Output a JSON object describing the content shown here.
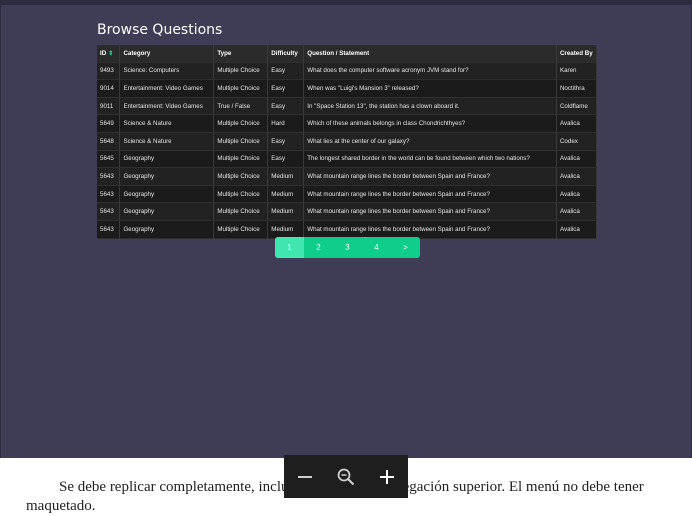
{
  "page": {
    "title": "Browse Questions"
  },
  "table": {
    "columns": {
      "id": "ID",
      "category": "Category",
      "type": "Type",
      "difficulty": "Difficulty",
      "question": "Question / Statement",
      "created_by": "Created By"
    },
    "rows": [
      {
        "id": "9493",
        "category": "Science: Computers",
        "type": "Multiple Choice",
        "difficulty": "Easy",
        "question": "What does the computer software acronym JVM stand for?",
        "created_by": "Karen"
      },
      {
        "id": "9014",
        "category": "Entertainment: Video Games",
        "type": "Multiple Choice",
        "difficulty": "Easy",
        "question": "When was \"Luigi's Mansion 3\" released?",
        "created_by": "Noctithra"
      },
      {
        "id": "9011",
        "category": "Entertainment: Video Games",
        "type": "True / False",
        "difficulty": "Easy",
        "question": "In \"Space Station 13\", the station has a clown aboard it.",
        "created_by": "Coldflame"
      },
      {
        "id": "5649",
        "category": "Science & Nature",
        "type": "Multiple Choice",
        "difficulty": "Hard",
        "question": "Which of these animals belongs in class Chondrichthyes?",
        "created_by": "Avalica"
      },
      {
        "id": "5648",
        "category": "Science & Nature",
        "type": "Multiple Choice",
        "difficulty": "Easy",
        "question": "What lies at the center of our galaxy?",
        "created_by": "Codex"
      },
      {
        "id": "5645",
        "category": "Geography",
        "type": "Multiple Choice",
        "difficulty": "Easy",
        "question": "The longest shared border in the world can be found between which two nations?",
        "created_by": "Avalica"
      },
      {
        "id": "5643",
        "category": "Geography",
        "type": "Multiple Choice",
        "difficulty": "Medium",
        "question": "What mountain range lines the border between Spain and France?",
        "created_by": "Avalica"
      },
      {
        "id": "5643",
        "category": "Geography",
        "type": "Multiple Choice",
        "difficulty": "Medium",
        "question": "What mountain range lines the border between Spain and France?",
        "created_by": "Avalica"
      },
      {
        "id": "5643",
        "category": "Geography",
        "type": "Multiple Choice",
        "difficulty": "Medium",
        "question": "What mountain range lines the border between Spain and France?",
        "created_by": "Avalica"
      },
      {
        "id": "5643",
        "category": "Geography",
        "type": "Multiple Choice",
        "difficulty": "Medium",
        "question": "What mountain range lines the border between Spain and France?",
        "created_by": "Avalica"
      }
    ]
  },
  "pagination": {
    "pages": [
      "1",
      "2",
      "3",
      "4",
      ">"
    ],
    "active": "1"
  },
  "zoom_controls": {
    "icons": [
      "minus-icon",
      "zoom-reset-icon",
      "plus-icon"
    ]
  },
  "document": {
    "line1": "Se debe replicar completamente, incluido el menú de navegación superior. El menú no debe tener",
    "line2": "maquetado."
  },
  "colors": {
    "viewer_bg": "#3f3d55",
    "table_bg": "#222222",
    "accent": "#1fe39a",
    "pager": "#0fce8c",
    "pager_active": "#3fe6b0"
  }
}
